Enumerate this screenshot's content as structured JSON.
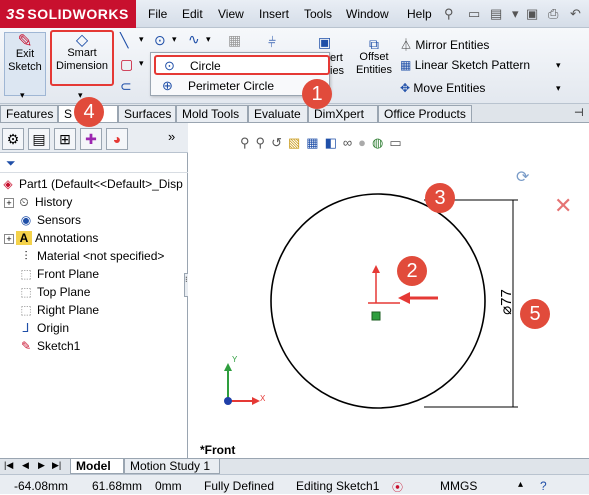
{
  "app": {
    "logo_prefix": "3S",
    "logo_text": "SOLIDWORKS"
  },
  "menu": [
    "File",
    "Edit",
    "View",
    "Insert",
    "Tools",
    "Window",
    "Help"
  ],
  "toolbar": {
    "exit_sketch": "Exit Sketch",
    "smart_dimension": "Smart Dimension",
    "offset_entities": "Offset Entities",
    "convert_partial": "ert",
    "convert_partial2": "ies",
    "mirror_entities": "Mirror Entities",
    "linear_sketch_pattern": "Linear Sketch Pattern",
    "move_entities": "Move Entities"
  },
  "circle_dropdown": {
    "items": [
      "Circle",
      "Perimeter Circle"
    ]
  },
  "tabs": [
    "Features",
    "S",
    "Surfaces",
    "Mold Tools",
    "Evaluate",
    "DimXpert",
    "Office Products"
  ],
  "tree": {
    "root": "Part1  (Default<<Default>_Disp",
    "items": [
      "History",
      "Sensors",
      "Annotations",
      "Material <not specified>",
      "Front Plane",
      "Top Plane",
      "Right Plane",
      "Origin",
      "Sketch1"
    ]
  },
  "graphics": {
    "view_label": "*Front",
    "dimension": "⌀77",
    "axis_x": "X",
    "axis_y": "Y"
  },
  "callouts": [
    "1",
    "2",
    "3",
    "4",
    "5"
  ],
  "bottom_tabs": [
    "Model",
    "Motion Study 1"
  ],
  "status": {
    "x": "-64.08mm",
    "y": "61.68mm",
    "z": "0mm",
    "state": "Fully Defined",
    "editing": "Editing Sketch1",
    "units": "MMGS"
  },
  "colors": {
    "callout": "#e14b3b",
    "highlight": "#e53935",
    "brand": "#c8102e"
  }
}
